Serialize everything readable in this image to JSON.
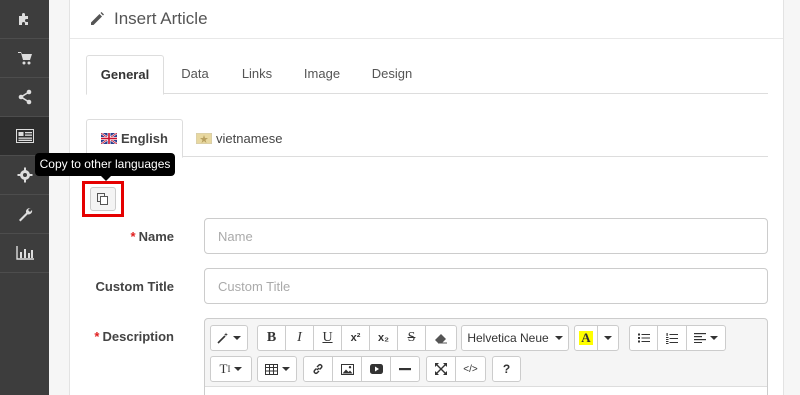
{
  "header": {
    "title": "Insert Article"
  },
  "sidebar": {
    "items": [
      {
        "icon": "puzzle-icon"
      },
      {
        "icon": "cart-icon"
      },
      {
        "icon": "share-icon"
      },
      {
        "icon": "newspaper-icon"
      },
      {
        "icon": "gear-icon"
      },
      {
        "icon": "wrench-icon"
      },
      {
        "icon": "bar-chart-icon"
      }
    ]
  },
  "tabs": [
    {
      "label": "General",
      "active": true
    },
    {
      "label": "Data"
    },
    {
      "label": "Links"
    },
    {
      "label": "Image"
    },
    {
      "label": "Design"
    }
  ],
  "language_tabs": [
    {
      "label": "English",
      "active": true
    },
    {
      "label": "vietnamese"
    }
  ],
  "tooltip": {
    "text": "Copy to other languages"
  },
  "form": {
    "name": {
      "label": "Name",
      "placeholder": "Name",
      "required": true
    },
    "custom_title": {
      "label": "Custom Title",
      "placeholder": "Custom Title"
    },
    "description": {
      "label": "Description",
      "required": true
    }
  },
  "editor": {
    "font_name": "Helvetica Neue",
    "text_size_label": "T",
    "bold": "B",
    "italic": "I",
    "underline": "U",
    "superscript": "x²",
    "subscript": "x₂",
    "strikethrough": "S",
    "highlight": "A",
    "help": "?",
    "code": "</>"
  },
  "colors": {
    "sidebar": "#3d3d3d",
    "highlight_yellow": "#ffff00",
    "required": "#e01e1e",
    "callout": "#e50000"
  }
}
